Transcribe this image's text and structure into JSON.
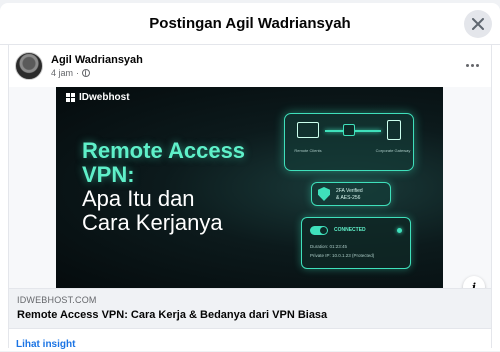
{
  "dialog": {
    "title": "Postingan Agil Wadriansyah"
  },
  "post": {
    "author": "Agil Wadriansyah",
    "time": "4 jam",
    "separator": "·"
  },
  "banner": {
    "brand": "IDwebhost",
    "headline": [
      "Remote Access",
      "VPN:",
      "Apa Itu dan",
      "Cara Kerjanya"
    ],
    "remote_caption": "Remote Clients",
    "gateway_caption": "Corporate Gateway",
    "shield_line1": "2FA Verified",
    "shield_line2": "& AES-256",
    "status_label": "CONNECTED",
    "session_line": "Duration: 01:23:45",
    "ip_line": "Private IP: 10.0.1.23 (Protected)",
    "accent_color": "#3fe0bb"
  },
  "link_preview": {
    "domain": "IDWEBHOST.COM",
    "title": "Remote Access VPN: Cara Kerja & Bedanya dari VPN Biasa"
  },
  "footer": {
    "insight_label": "Lihat insight",
    "link_color": "#1b74e4"
  }
}
